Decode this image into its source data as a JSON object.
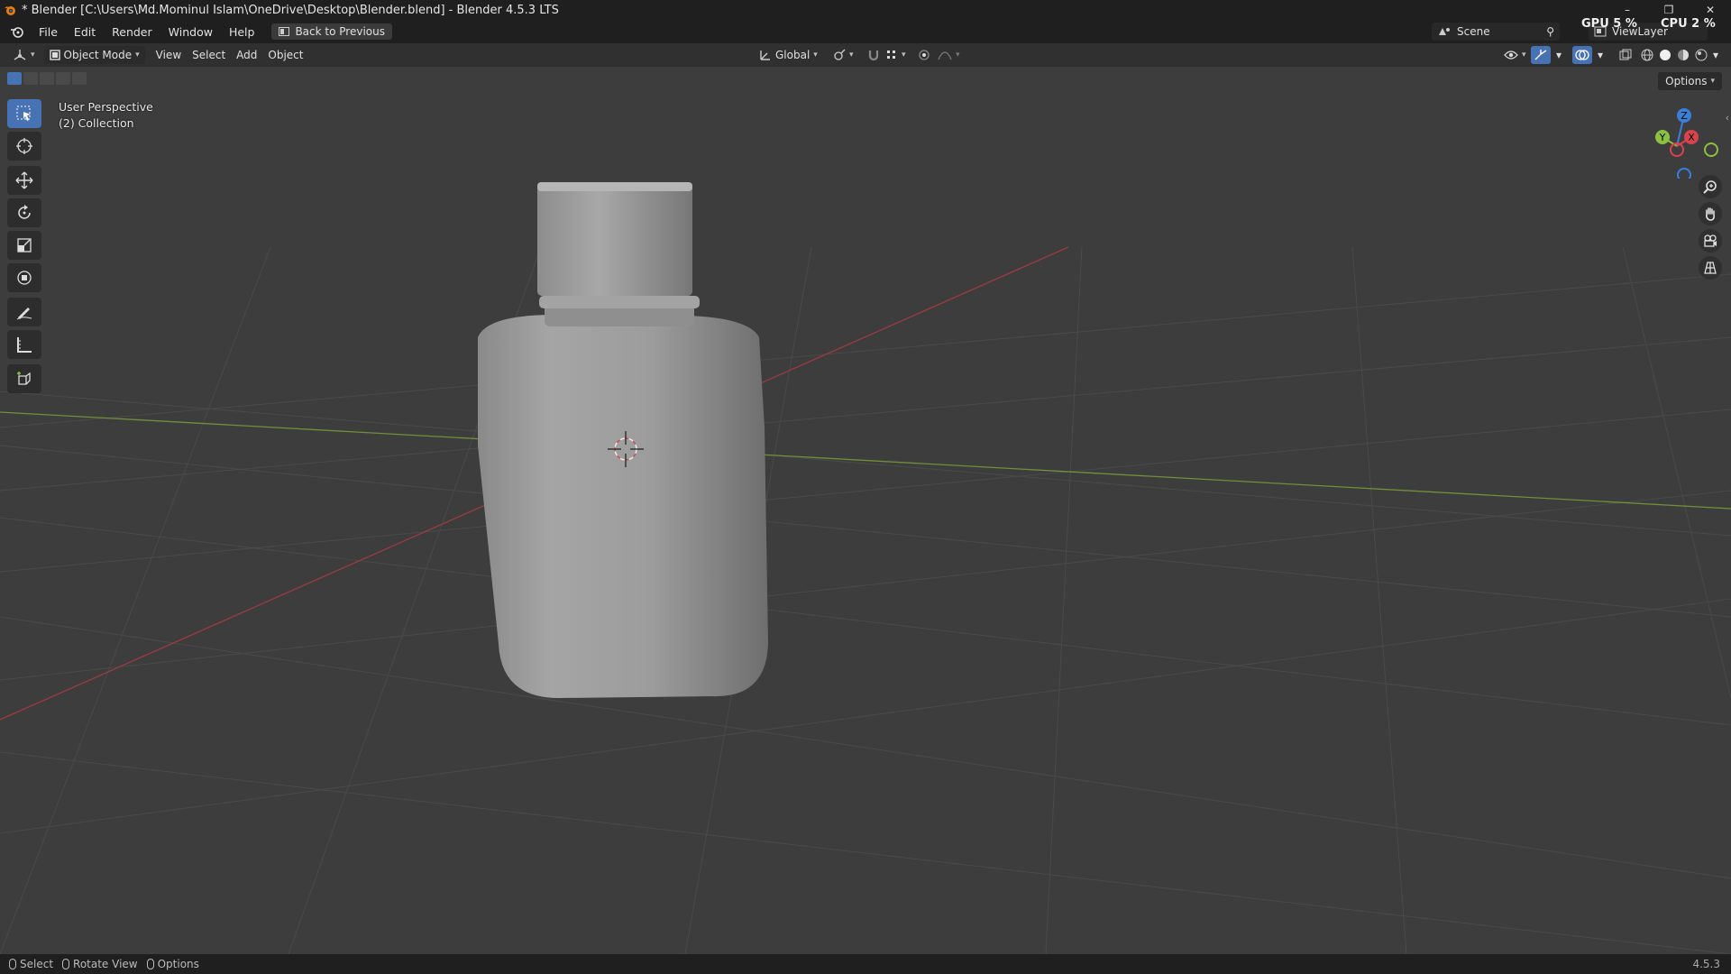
{
  "window": {
    "title": "* Blender [C:\\Users\\Md.Mominul Islam\\OneDrive\\Desktop\\Blender.blend] - Blender 4.5.3 LTS",
    "minimize": "–",
    "restore": "❐",
    "close": "✕"
  },
  "menu": {
    "items": [
      "File",
      "Edit",
      "Render",
      "Window",
      "Help"
    ],
    "back_button": "Back to Previous"
  },
  "top_right": {
    "scene_label": "Scene",
    "viewlayer_label": "ViewLayer",
    "gpu": "GPU  5 %",
    "cpu": "CPU  2 %"
  },
  "header": {
    "mode": "Object Mode",
    "menus": [
      "View",
      "Select",
      "Add",
      "Object"
    ],
    "transform_orientation": "Global"
  },
  "viewport": {
    "view_name": "User Perspective",
    "collection": "(2) Collection",
    "options_label": "Options",
    "gizmo": {
      "z": "Z",
      "y": "Y",
      "x": "X"
    }
  },
  "tools": [
    "select-box-tool",
    "cursor-tool",
    "move-tool",
    "rotate-tool",
    "scale-tool",
    "transform-tool",
    "annotate-tool",
    "measure-tool",
    "add-cube-tool"
  ],
  "statusbar": {
    "select": "Select",
    "rotate": "Rotate View",
    "options": "Options",
    "version": "4.5.3"
  },
  "colors": {
    "accent": "#4772b3",
    "x_axis": "#d9434f",
    "y_axis": "#8cc043",
    "z_axis": "#3a7fd9"
  }
}
